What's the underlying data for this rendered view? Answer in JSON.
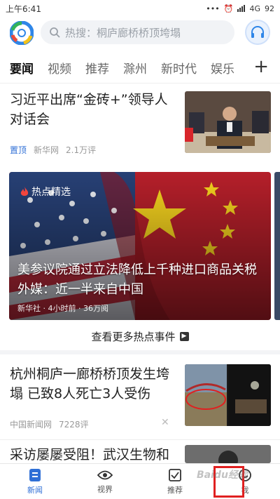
{
  "status_bar": {
    "time": "上午6:41",
    "network": "4G",
    "battery": "92"
  },
  "search": {
    "placeholder": "热搜：桐庐廊桥桥顶垮塌"
  },
  "tabs": [
    {
      "label": "要闻"
    },
    {
      "label": "视频"
    },
    {
      "label": "推荐"
    },
    {
      "label": "滁州"
    },
    {
      "label": "新时代"
    },
    {
      "label": "娱乐"
    }
  ],
  "tab_add": "+",
  "news": [
    {
      "title": "习近平出席“金砖+”领导人对话会",
      "tag": "置顶",
      "source": "新华网",
      "comments": "2.1万评"
    },
    {
      "title": "杭州桐庐一廊桥桥顶发生垮塌 已致8人死亡3人受伤",
      "source": "中国新闻网",
      "comments": "7228评"
    },
    {
      "title": "采访屡屡受阻！武汉生物和"
    }
  ],
  "banner": {
    "tag": "热点精选",
    "title": "美参议院通过立法降低上千种进口商品关税 外媒：近一半来自中国",
    "meta": "新华社 · 4小时前 · 36万阅"
  },
  "more_hot": "查看更多热点事件",
  "bottom_nav": [
    {
      "label": "新闻",
      "icon": "news-icon",
      "active": true
    },
    {
      "label": "视界",
      "icon": "eye-icon"
    },
    {
      "label": "推荐",
      "icon": "check-icon"
    },
    {
      "label": "我",
      "icon": "smile-icon"
    }
  ],
  "watermark": "Baidu经验",
  "colors": {
    "accent": "#2f6fd6",
    "highlight": "#e02020"
  }
}
